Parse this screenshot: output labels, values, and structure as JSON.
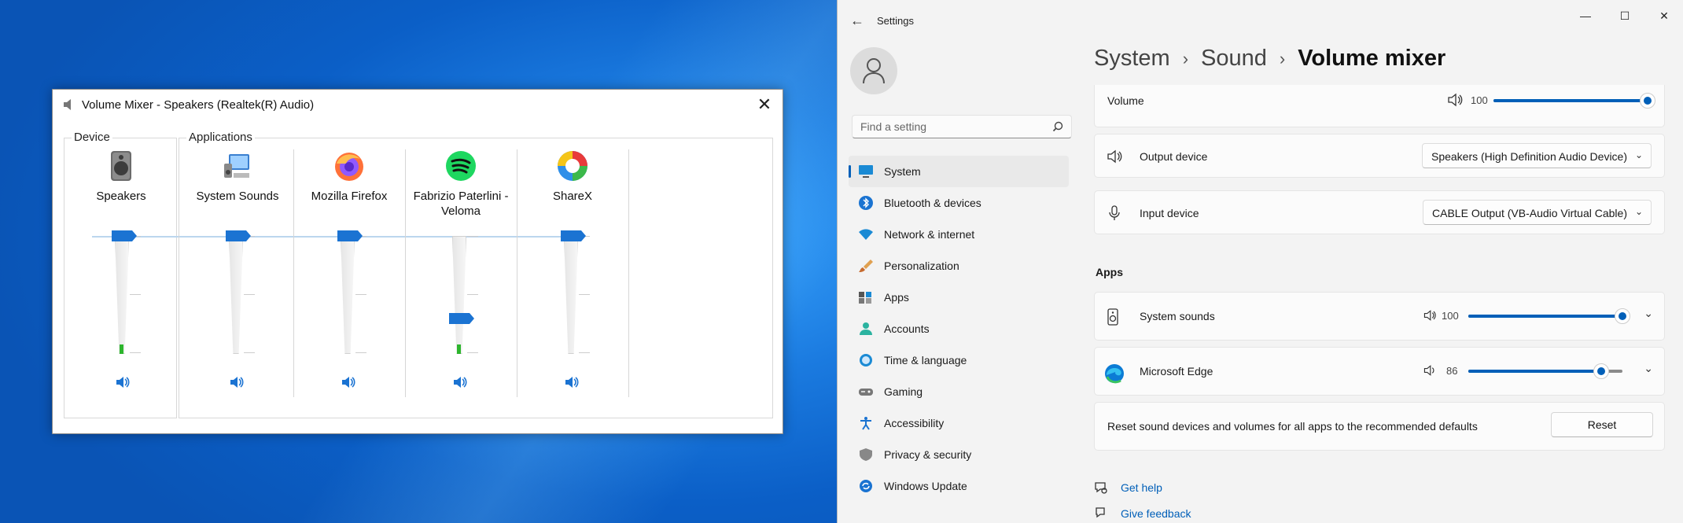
{
  "mixer": {
    "title": "Volume Mixer - Speakers (Realtek(R) Audio)",
    "device_group": "Device",
    "apps_group": "Applications",
    "channels": [
      {
        "name": "Speakers",
        "level": 1.0,
        "meter": 0.08
      },
      {
        "name": "System Sounds",
        "level": 1.0,
        "meter": 0
      },
      {
        "name": "Mozilla Firefox",
        "level": 1.0,
        "meter": 0
      },
      {
        "name": "Fabrizio Paterlini - Veloma",
        "level": 0.3,
        "meter": 0.08
      },
      {
        "name": "ShareX",
        "level": 1.0,
        "meter": 0
      }
    ]
  },
  "settings": {
    "app_title": "Settings",
    "search_placeholder": "Find a setting",
    "nav": [
      {
        "label": "System",
        "selected": true
      },
      {
        "label": "Bluetooth & devices"
      },
      {
        "label": "Network & internet"
      },
      {
        "label": "Personalization"
      },
      {
        "label": "Apps"
      },
      {
        "label": "Accounts"
      },
      {
        "label": "Time & language"
      },
      {
        "label": "Gaming"
      },
      {
        "label": "Accessibility"
      },
      {
        "label": "Privacy & security"
      },
      {
        "label": "Windows Update"
      }
    ],
    "breadcrumb": {
      "a": "System",
      "b": "Sound",
      "current": "Volume mixer"
    },
    "volume": {
      "label": "Volume",
      "value": "100"
    },
    "output": {
      "label": "Output device",
      "value": "Speakers (High Definition Audio Device)"
    },
    "input": {
      "label": "Input device",
      "value": "CABLE Output (VB-Audio Virtual Cable)"
    },
    "apps_heading": "Apps",
    "apps": [
      {
        "name": "System sounds",
        "value": "100"
      },
      {
        "name": "Microsoft Edge",
        "value": "86"
      }
    ],
    "reset": {
      "text": "Reset sound devices and volumes for all apps to the recommended defaults",
      "button": "Reset"
    },
    "help": "Get help",
    "feedback": "Give feedback"
  },
  "colors": {
    "accent": "#005fb8",
    "mixer_thumb": "#1b73d2",
    "meter": "#2db52d"
  }
}
